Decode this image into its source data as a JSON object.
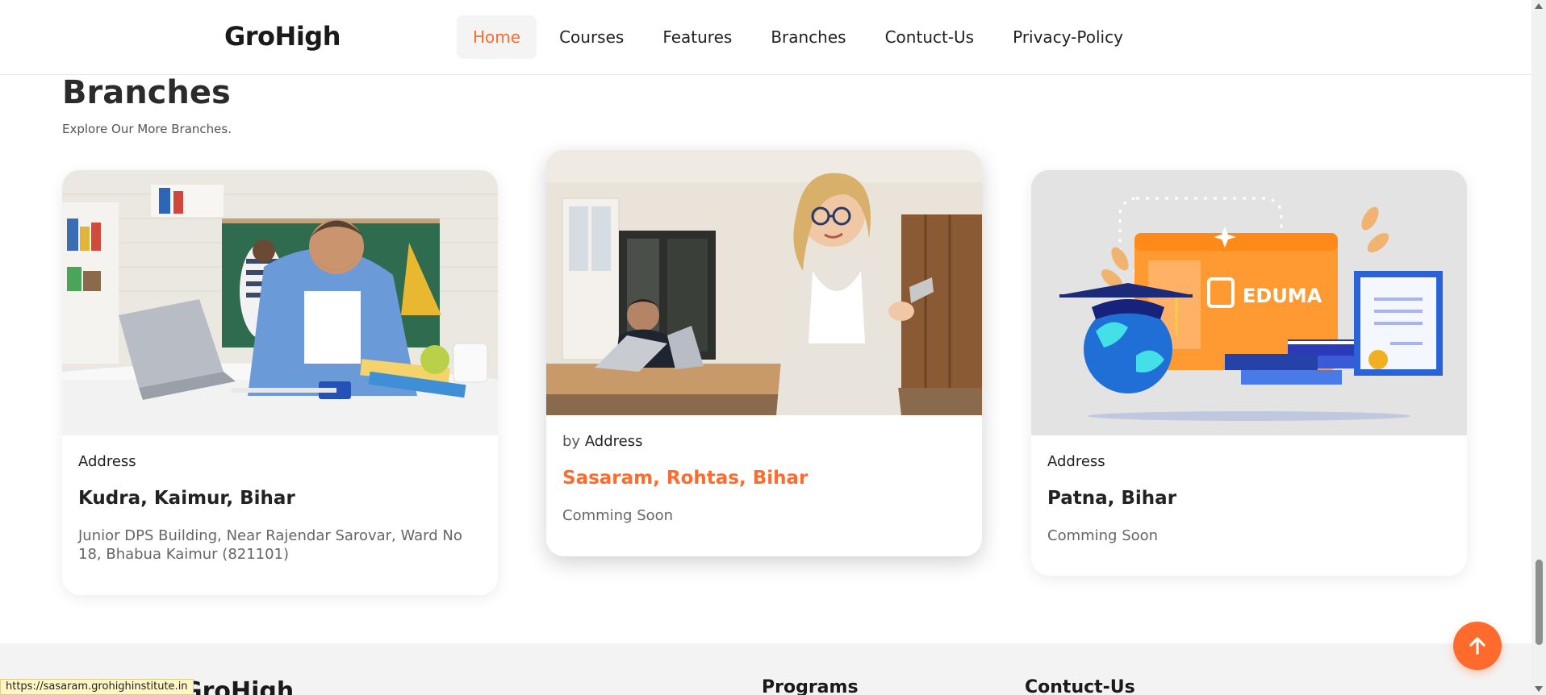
{
  "header": {
    "logo": "GroHigh",
    "nav": [
      "Home",
      "Courses",
      "Features",
      "Branches",
      "Contuct-Us",
      "Privacy-Policy"
    ],
    "active": "Home"
  },
  "section": {
    "title": "Branches",
    "subtitle": "Explore Our More Branches."
  },
  "cards": [
    {
      "tag": "Address",
      "place": "Kudra, Kaimur, Bihar",
      "desc": "Junior DPS Building, Near Rajendar Sarovar, Ward No 18, Bhabua Kaimur (821101)"
    },
    {
      "by": "by",
      "tag": "Address",
      "place": "Sasaram, Rohtas, Bihar",
      "desc": "Comming Soon"
    },
    {
      "tag": "Address",
      "place": "Patna, Bihar",
      "desc": "Comming Soon",
      "image_text": "EDUMA"
    }
  ],
  "footer": {
    "logo": "GroHigh",
    "col1": "Programs",
    "col2": "Contuct-Us"
  },
  "status_url": "https://sasaram.grohighinstitute.in",
  "colors": {
    "accent": "#ff6b2c"
  },
  "icons": {
    "scroll_top": "arrow-up-icon"
  }
}
